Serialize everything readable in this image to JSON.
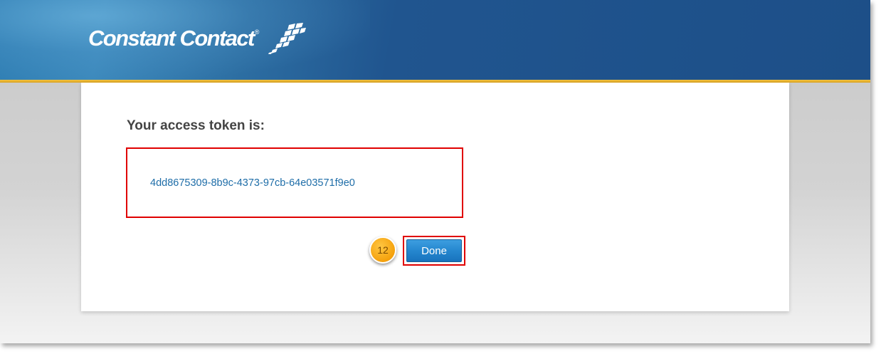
{
  "header": {
    "brand_name": "Constant Contact",
    "brand_reg_mark": "®",
    "colors": {
      "header_blue": "#1d4f88",
      "accent_gold": "#f4c543"
    }
  },
  "main": {
    "heading": "Your access token is:",
    "token_value": "4dd8675309-8b9c-4373-97cb-64e03571f9e0",
    "step_badge": "12",
    "done_button_label": "Done",
    "colors": {
      "highlight_red": "#e00000",
      "link_blue": "#1e6da8",
      "button_blue": "#2587cf",
      "badge_orange": "#f5a10c"
    }
  },
  "icons": {
    "logo_flag": "checkered-flag-icon"
  }
}
